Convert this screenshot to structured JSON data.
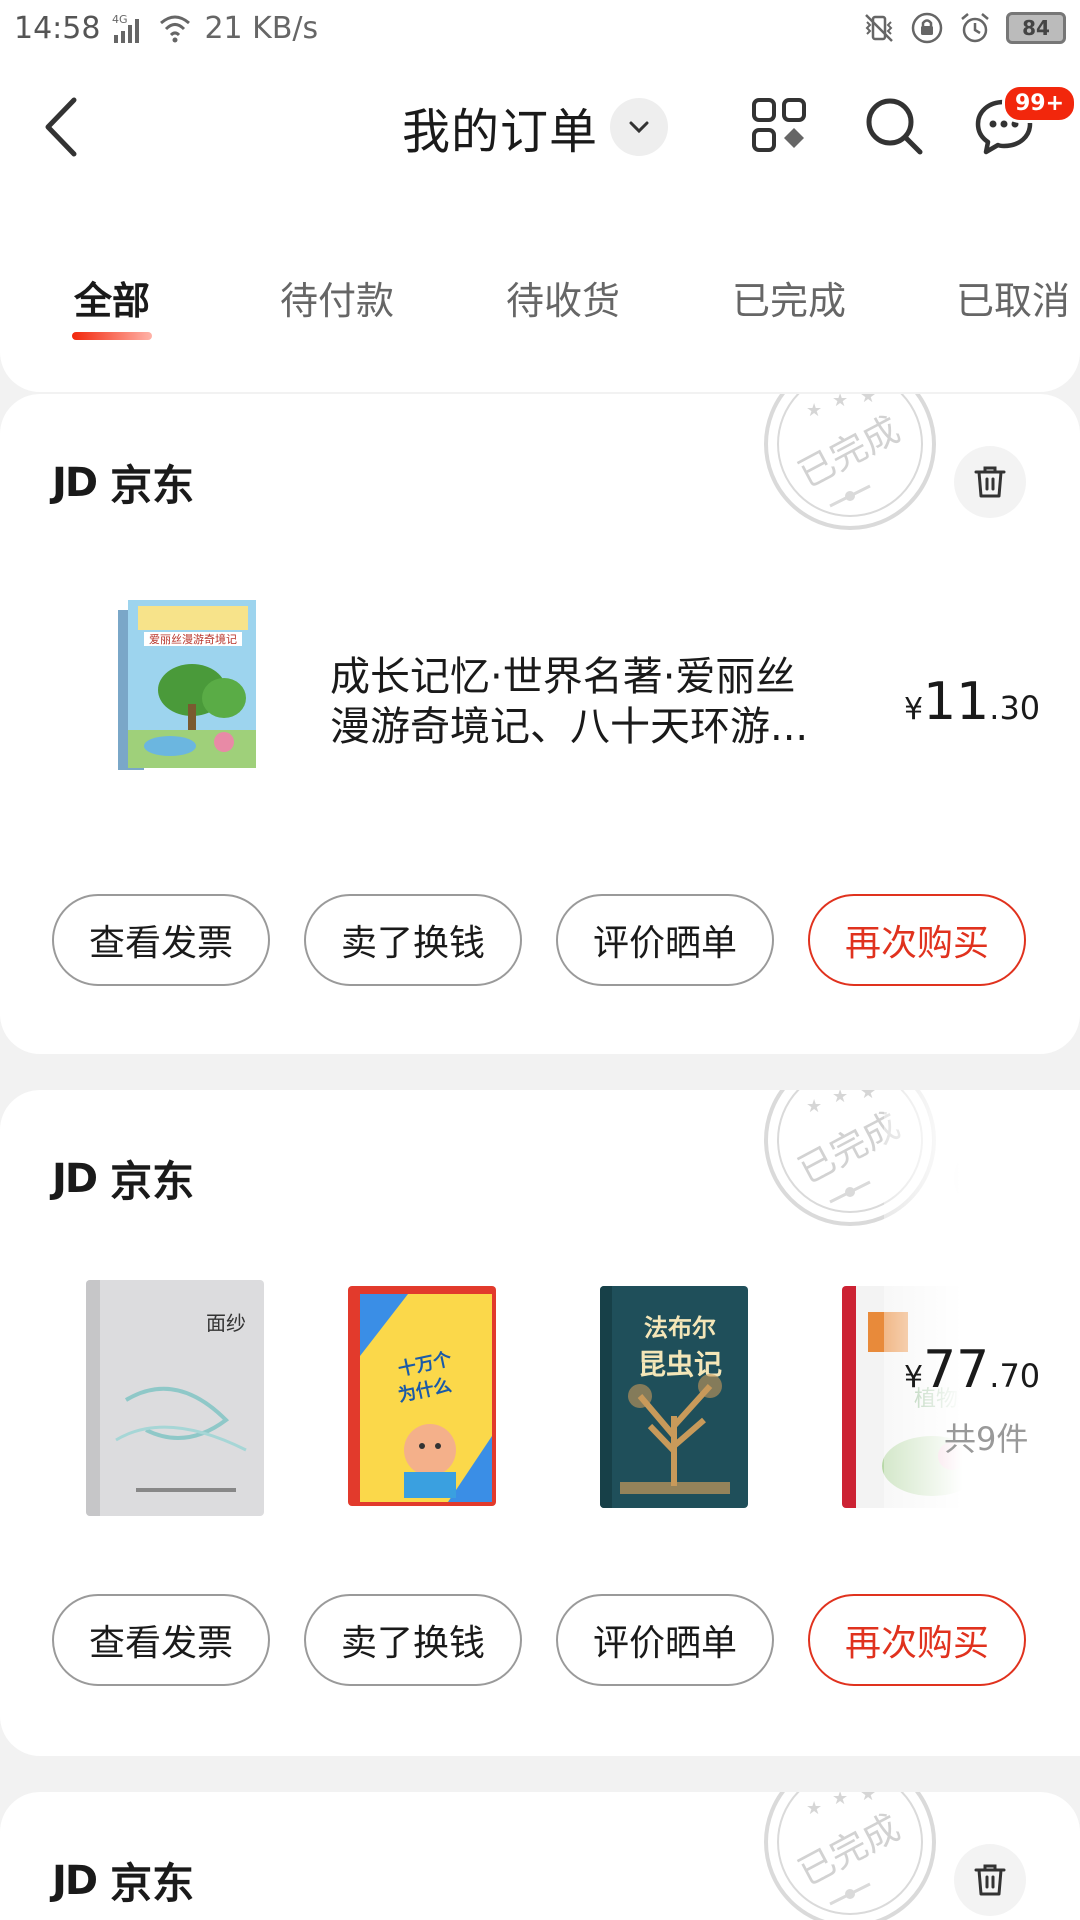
{
  "status": {
    "time": "14:58",
    "network": "21 KB/s",
    "battery": "84"
  },
  "nav": {
    "title": "我的订单",
    "badge": "99+"
  },
  "tabs": [
    "全部",
    "待付款",
    "待收货",
    "已完成",
    "已取消"
  ],
  "stamp_text": "已完成",
  "orders": [
    {
      "shop": "京东",
      "shop_logo": "JD",
      "title": "成长记忆·世界名著·爱丽丝漫游奇境记、八十天环游...",
      "price_currency": "¥",
      "price_int": "11",
      "price_dec": ".30",
      "actions": [
        "查看发票",
        "卖了换钱",
        "评价晒单",
        "再次购买"
      ]
    },
    {
      "shop": "京东",
      "shop_logo": "JD",
      "price_currency": "¥",
      "price_int": "77",
      "price_dec": ".70",
      "count": "共9件",
      "book_titles": [
        "面纱",
        "幼儿十万个为什么",
        "法布尔昆虫记",
        "植物百科"
      ],
      "actions": [
        "查看发票",
        "卖了换钱",
        "评价晒单",
        "再次购买"
      ]
    },
    {
      "shop": "京东",
      "shop_logo": "JD"
    }
  ],
  "colors": {
    "accent": "#f2270c",
    "stamp": "#d6d6d6",
    "background": "#f2f2f2"
  }
}
